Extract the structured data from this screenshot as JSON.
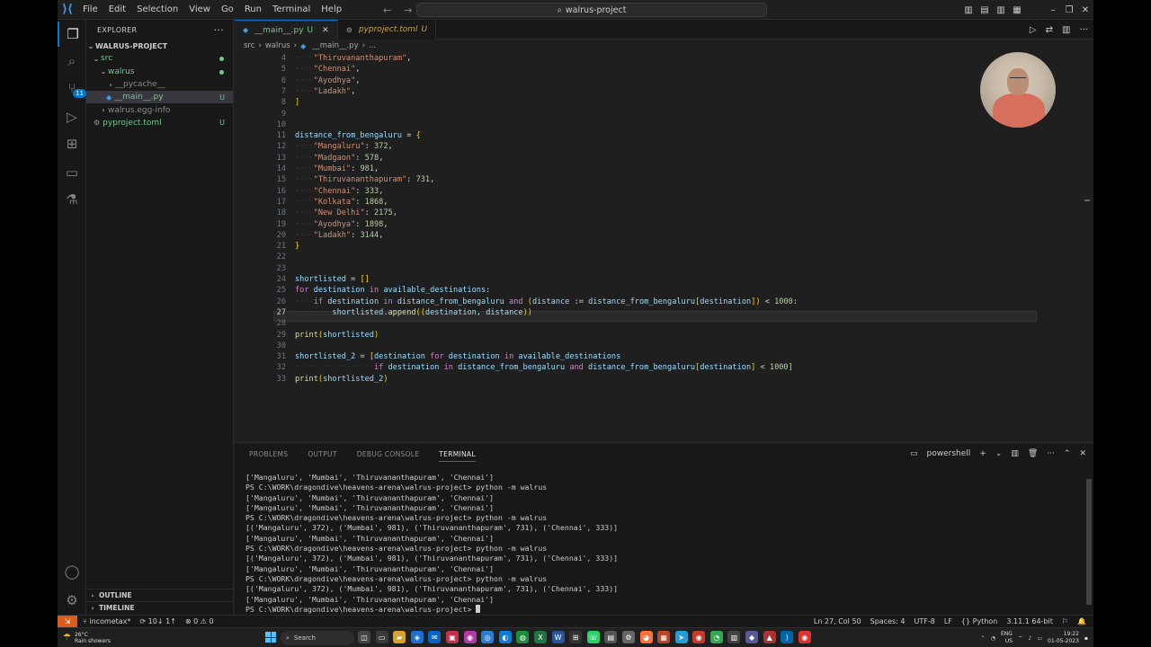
{
  "titlebar": {
    "menu": [
      "File",
      "Edit",
      "Selection",
      "View",
      "Go",
      "Run",
      "Terminal",
      "Help"
    ],
    "search": "walrus-project"
  },
  "explorer": {
    "title": "EXPLORER",
    "root": "WALRUS-PROJECT",
    "items": [
      {
        "label": "src",
        "level": 1,
        "chev": "⌄"
      },
      {
        "label": "walrus",
        "level": 2,
        "chev": "⌄"
      },
      {
        "label": "__pycache__",
        "level": 3,
        "chev": "›"
      },
      {
        "label": "__main__.py",
        "level": 3,
        "mark": "U"
      },
      {
        "label": "walrus.egg-info",
        "level": 2,
        "chev": "›"
      },
      {
        "label": "pyproject.toml",
        "level": 1,
        "mark": "U"
      }
    ],
    "outline": "OUTLINE",
    "timeline": "TIMELINE"
  },
  "tabs": [
    {
      "label": "__main__.py",
      "mark": "U"
    },
    {
      "label": "pyproject.toml",
      "mark": "U"
    }
  ],
  "breadcrumb": [
    "src",
    "walrus",
    "__main__.py",
    "..."
  ],
  "code": {
    "lines": [
      {
        "n": "4",
        "t": "    \"Thiruvananthapuram\","
      },
      {
        "n": "5",
        "t": "    \"Chennai\","
      },
      {
        "n": "6",
        "t": "    \"Ayodhya\","
      },
      {
        "n": "7",
        "t": "    \"Ladakh\","
      },
      {
        "n": "8",
        "t": "]"
      },
      {
        "n": "9",
        "t": ""
      },
      {
        "n": "10",
        "t": ""
      },
      {
        "n": "11",
        "t": "distance_from_bengaluru = {"
      },
      {
        "n": "12",
        "t": "    \"Mangaluru\": 372,"
      },
      {
        "n": "13",
        "t": "    \"Madgaon\": 578,"
      },
      {
        "n": "14",
        "t": "    \"Mumbai\": 981,"
      },
      {
        "n": "15",
        "t": "    \"Thiruvananthapuram\": 731,"
      },
      {
        "n": "16",
        "t": "    \"Chennai\": 333,"
      },
      {
        "n": "17",
        "t": "    \"Kolkata\": 1868,"
      },
      {
        "n": "18",
        "t": "    \"New Delhi\": 2175,"
      },
      {
        "n": "19",
        "t": "    \"Ayodhya\": 1898,"
      },
      {
        "n": "20",
        "t": "    \"Ladakh\": 3144,"
      },
      {
        "n": "21",
        "t": "}"
      },
      {
        "n": "22",
        "t": ""
      },
      {
        "n": "23",
        "t": ""
      },
      {
        "n": "24",
        "t": "shortlisted = []"
      },
      {
        "n": "25",
        "t": "for destination in available_destinations:"
      },
      {
        "n": "26",
        "t": "    if destination in distance_from_bengaluru and (distance := distance_from_bengaluru[destination]) < 1000:"
      },
      {
        "n": "27",
        "t": "        shortlisted.append((destination, distance))"
      },
      {
        "n": "28",
        "t": ""
      },
      {
        "n": "29",
        "t": "print(shortlisted)"
      },
      {
        "n": "30",
        "t": ""
      },
      {
        "n": "31",
        "t": "shortlisted_2 = [destination for destination in available_destinations"
      },
      {
        "n": "32",
        "t": "                 if destination in distance_from_bengaluru and distance_from_bengaluru[destination] < 1000]"
      },
      {
        "n": "33",
        "t": "print(shortlisted_2)"
      }
    ],
    "current_line": "27"
  },
  "panel": {
    "tabs": [
      "PROBLEMS",
      "OUTPUT",
      "DEBUG CONSOLE",
      "TERMINAL"
    ],
    "shell": "powershell",
    "lines": [
      "['Mangaluru', 'Mumbai', 'Thiruvananthapuram', 'Chennai']",
      "PS C:\\WORK\\dragondive\\heavens-arena\\walrus-project> python -m walrus",
      "['Mangaluru', 'Mumbai', 'Thiruvananthapuram', 'Chennai']",
      "['Mangaluru', 'Mumbai', 'Thiruvananthapuram', 'Chennai']",
      "PS C:\\WORK\\dragondive\\heavens-arena\\walrus-project> python -m walrus",
      "[('Mangaluru', 372), ('Mumbai', 981), ('Thiruvananthapuram', 731), ('Chennai', 333)]",
      "['Mangaluru', 'Mumbai', 'Thiruvananthapuram', 'Chennai']",
      "PS C:\\WORK\\dragondive\\heavens-arena\\walrus-project> python -m walrus",
      "[('Mangaluru', 372), ('Mumbai', 981), ('Thiruvananthapuram', 731), ('Chennai', 333)]",
      "['Mangaluru', 'Mumbai', 'Thiruvananthapuram', 'Chennai']",
      "PS C:\\WORK\\dragondive\\heavens-arena\\walrus-project> python -m walrus",
      "[('Mangaluru', 372), ('Mumbai', 981), ('Thiruvananthapuram', 731), ('Chennai', 333)]",
      "['Mangaluru', 'Mumbai', 'Thiruvananthapuram', 'Chennai']"
    ],
    "prompt": "PS C:\\WORK\\dragondive\\heavens-arena\\walrus-project> "
  },
  "statusbar": {
    "branch": "incometax*",
    "sync": "10↓ 1↑",
    "problems": "⊗ 0 ⚠ 0",
    "position": "Ln 27, Col 50",
    "spaces": "Spaces: 4",
    "encoding": "UTF-8",
    "eol": "LF",
    "language": "Python",
    "interpreter": "3.11.1 64-bit"
  },
  "taskbar": {
    "temp": "26°C",
    "weather": "Rain showers",
    "search": "Search",
    "lang": "ENG",
    "region": "US",
    "time": "19:22",
    "date": "01-05-2023"
  },
  "colors": {
    "accent": "#0078d4",
    "remote": "#d85c1f",
    "untracked": "#73c991"
  }
}
